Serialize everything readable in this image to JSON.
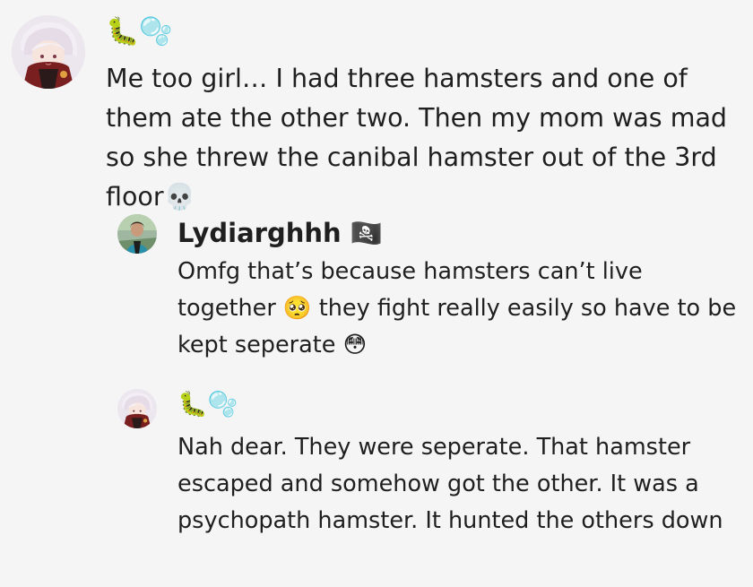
{
  "comments": [
    {
      "username": "🐛🫧",
      "text": "Me too girl… I had three hamsters and one of them ate the other two. Then my mom was mad so she threw the canibal hamster out of the 3rd floor💀",
      "avatar_icon": "anime-character-avatar"
    },
    {
      "username": "Lydiarghhh 🏴‍☠️",
      "text": "Omfg that’s because hamsters can’t live together 🥺 they fight really easily so have to be kept seperate 😳",
      "avatar_icon": "person-photo-avatar"
    },
    {
      "username": "🐛🫧",
      "text": "Nah dear. They were seperate. That hamster escaped and somehow got the other. It was a psychopath hamster. It hunted the others down",
      "avatar_icon": "anime-character-avatar"
    }
  ]
}
